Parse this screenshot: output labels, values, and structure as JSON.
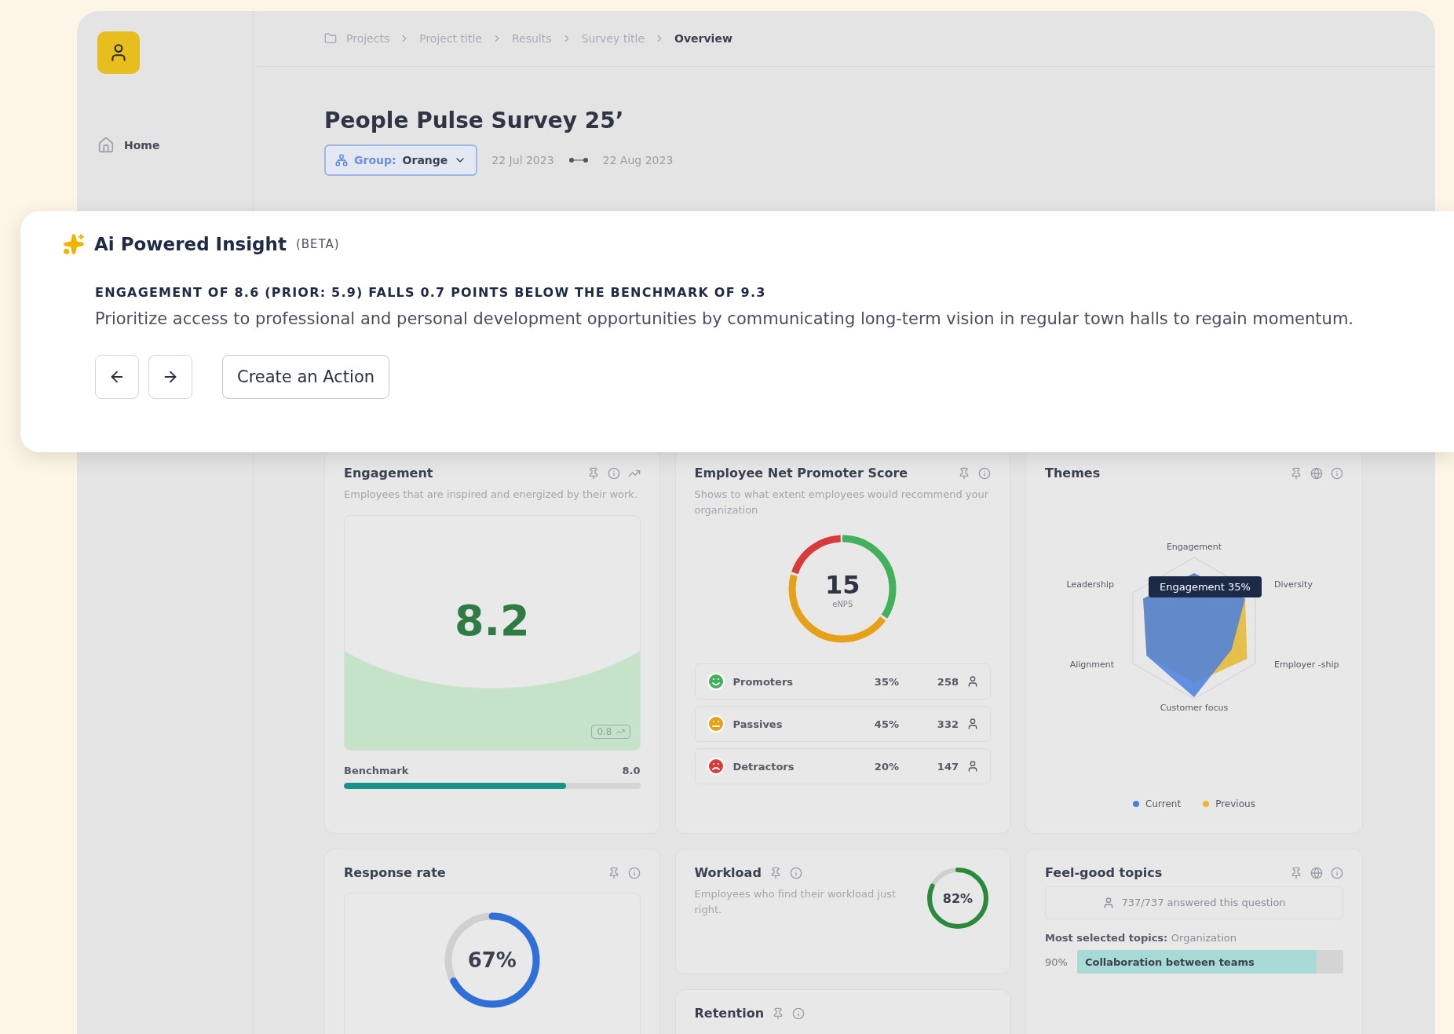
{
  "sidebar": {
    "items": [
      {
        "label": "Home",
        "selected": false
      }
    ]
  },
  "breadcrumb": [
    {
      "label": "Projects"
    },
    {
      "label": "Project title"
    },
    {
      "label": "Results"
    },
    {
      "label": "Survey title"
    },
    {
      "label": "Overview"
    }
  ],
  "page": {
    "title": "People Pulse Survey 25’",
    "group": {
      "label": "Group:",
      "value": "Orange"
    },
    "date_from": "22 Jul 2023",
    "date_to": "22 Aug 2023"
  },
  "insight": {
    "title": "Ai Powered Insight",
    "badge": "(BETA)",
    "headline": "ENGAGEMENT OF 8.6 (PRIOR: 5.9) FALLS 0.7 POINTS BELOW THE BENCHMARK OF 9.3",
    "body": "Prioritize access to professional and personal development opportunities by communicating long-term vision in regular town halls to regain momentum.",
    "action": "Create an Action"
  },
  "engagement": {
    "title": "Engagement",
    "subtitle": "Employees that are inspired and energized by their work.",
    "score": "8.2",
    "delta": "0.8",
    "benchmark_label": "Benchmark",
    "benchmark_value": "8.0",
    "level": 0.75
  },
  "enps": {
    "title": "Employee Net Promoter Score",
    "subtitle": "Shows to what extent employees would recommend your organization",
    "score": "15",
    "score_label": "eNPS",
    "groups": [
      {
        "kind": "happy",
        "label": "Promoters",
        "share": "35%",
        "count": "258",
        "color": "#43b05c"
      },
      {
        "kind": "neutral",
        "label": "Passives",
        "share": "45%",
        "count": "332",
        "color": "#e6a117"
      },
      {
        "kind": "sad",
        "label": "Detractors",
        "share": "20%",
        "count": "147",
        "color": "#d93a3a"
      }
    ]
  },
  "themes": {
    "title": "Themes",
    "axes": [
      "Engagement",
      "Diversity",
      "Employer -ship",
      "Customer focus",
      "Alignment",
      "Leadership"
    ],
    "tooltip": "Engagement 35%",
    "legend": [
      {
        "label": "Current",
        "color": "#4a7fe0"
      },
      {
        "label": "Previous",
        "color": "#e6b830"
      }
    ]
  },
  "response_rate": {
    "title": "Response rate",
    "reading": "67%",
    "level": 0.67
  },
  "workload": {
    "title": "Workload",
    "subtitle": "Employees who find their workload just right.",
    "reading": "82%",
    "level": 0.82
  },
  "retention": {
    "title": "Retention"
  },
  "feel_good": {
    "title": "Feel-good topics",
    "answered": "737/737 answered this question",
    "most_label": "Most selected topics:",
    "most_value": "Organization",
    "bars": [
      {
        "share": "90%",
        "label": "Collaboration between teams",
        "level": 0.9
      }
    ]
  }
}
